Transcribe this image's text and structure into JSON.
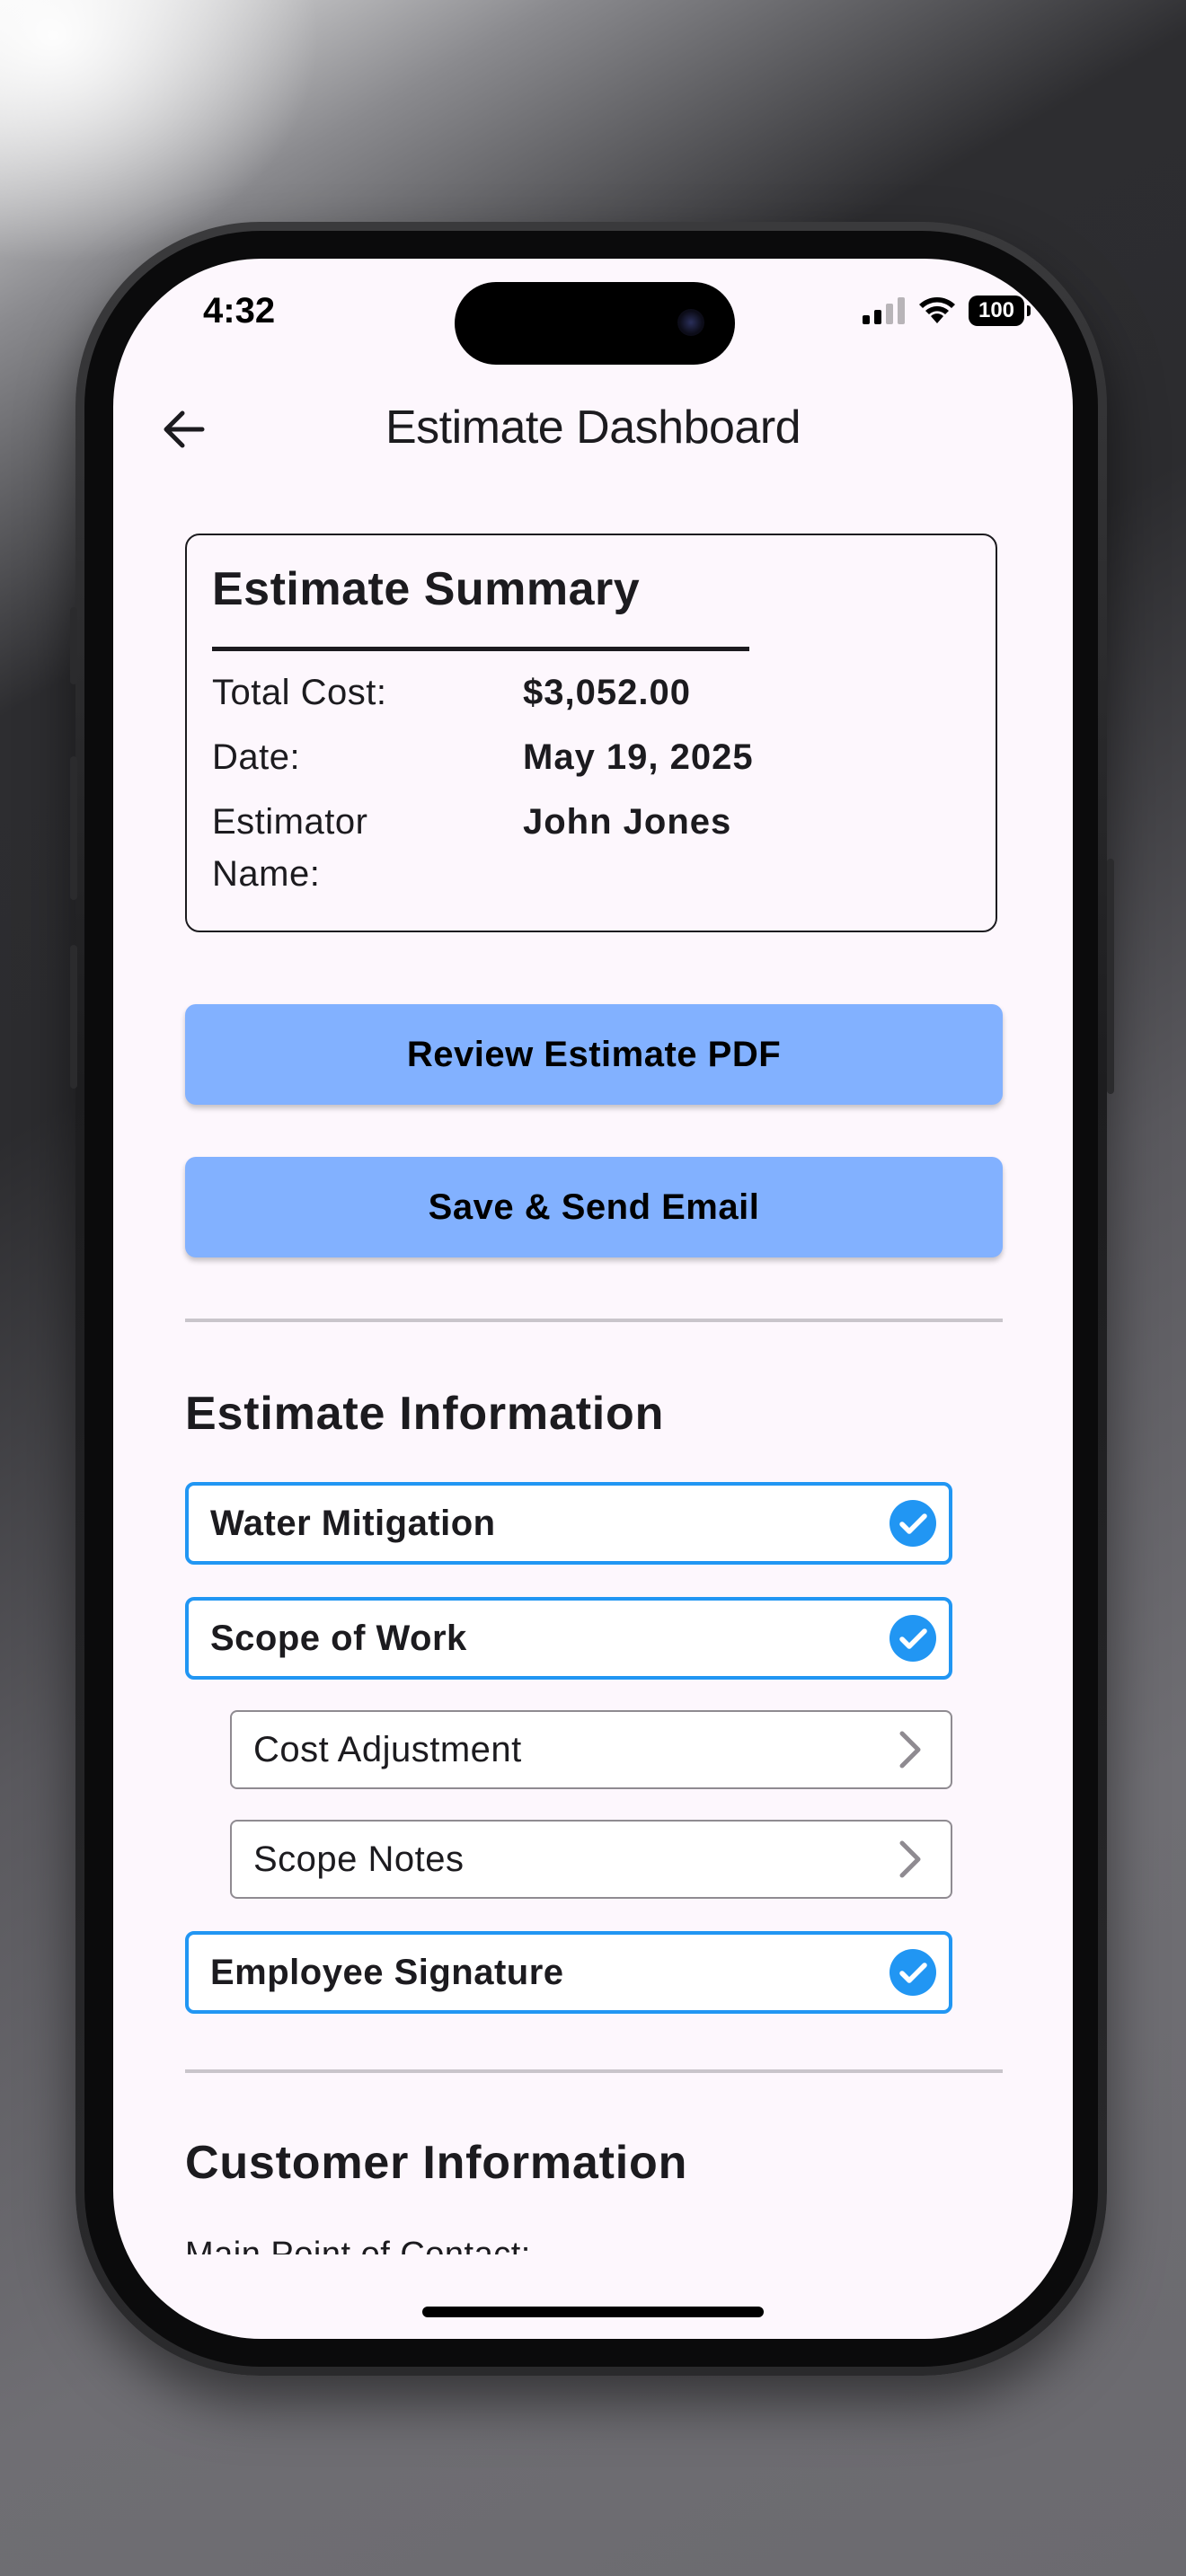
{
  "status_bar": {
    "time": "4:32",
    "battery": "100"
  },
  "header": {
    "title": "Estimate Dashboard",
    "back_icon": "arrow-left-icon"
  },
  "summary": {
    "title": "Estimate Summary",
    "rows": [
      {
        "label": "Total Cost:",
        "value": "$3,052.00"
      },
      {
        "label": "Date:",
        "value": "May 19, 2025"
      },
      {
        "label": "Estimator\nName:",
        "value": "John Jones"
      }
    ]
  },
  "actions": {
    "review_label": "Review Estimate PDF",
    "send_label": "Save & Send Email"
  },
  "estimate_info": {
    "title": "Estimate Information",
    "items": [
      {
        "label": "Water Mitigation",
        "state": "complete"
      },
      {
        "label": "Scope of Work",
        "state": "complete"
      },
      {
        "label": "Cost Adjustment",
        "state": "sub-item"
      },
      {
        "label": "Scope Notes",
        "state": "sub-item"
      },
      {
        "label": "Employee Signature",
        "state": "complete"
      }
    ]
  },
  "customer_info": {
    "title": "Customer Information",
    "contact_label": "Main Point of Contact:"
  },
  "colors": {
    "accent_button": "#82b1ff",
    "check_border": "#2196f3",
    "screen_background": "#fdf7fd"
  }
}
